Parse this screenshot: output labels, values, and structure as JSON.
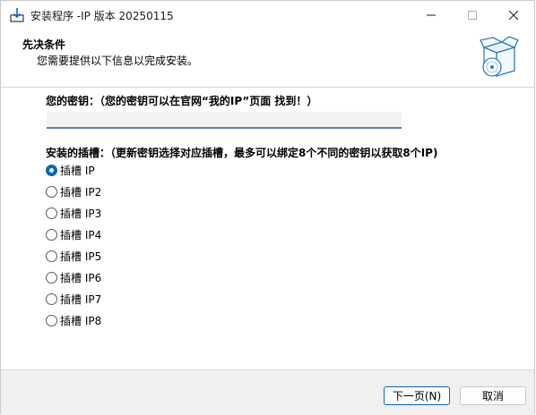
{
  "window": {
    "title": "安装程序 -IP 版本 20250115"
  },
  "header": {
    "title": "先决条件",
    "subtitle": "您需要提供以下信息以完成安装。"
  },
  "key": {
    "label": "您的密钥：（您的密钥可以在官网“我的IP”页面 找到！）",
    "value": ""
  },
  "slots": {
    "label": "安装的插槽：（更新密钥选择对应插槽，最多可以绑定8个不同的密钥以获取8个IP)",
    "options": [
      "插槽 IP",
      "插槽 IP2",
      "插槽 IP3",
      "插槽 IP4",
      "插槽 IP5",
      "插槽 IP6",
      "插槽 IP7",
      "插槽 IP8"
    ],
    "selected": "插槽 IP"
  },
  "buttons": {
    "next": "下一页(N)",
    "cancel": "取消"
  },
  "colors": {
    "accent": "#0067c0",
    "footer_bg": "#f0f0f0",
    "input_underline": "#5a7fa8"
  }
}
